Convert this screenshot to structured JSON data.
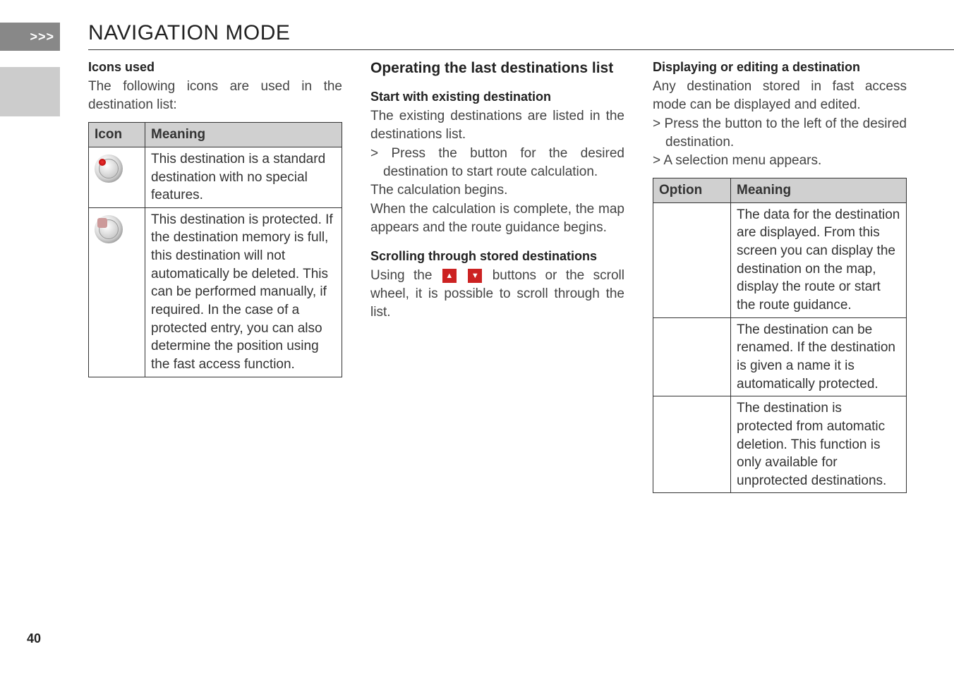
{
  "header": {
    "tab": ">>>",
    "title": "NAVIGATION MODE"
  },
  "page_number": "40",
  "col1": {
    "heading": "Icons used",
    "intro": "The following icons are used in the destination list:",
    "table": {
      "h1": "Icon",
      "h2": "Meaning",
      "r1": "This destination is a standard destination with no special features.",
      "r2": "This destination is protected. If the destination memory is full, this destination will not automatically be deleted. This can be performed manually, if required.\nIn the case of a protected entry, you can also determine the position using the fast access function."
    }
  },
  "col2": {
    "section": "Operating the last destinations list",
    "sub1": "Start with existing destination",
    "p1": "The existing destinations are listed in the destinations list.",
    "li1": "> Press the button for the desired destination to start route calculation.",
    "p2": "The calculation begins.",
    "p3": "When the calculation is complete, the map appears and the route guidance begins.",
    "sub2": "Scrolling through stored destinations",
    "p4a": "Using the ",
    "p4b": " buttons or the scroll wheel, it is possible to scroll through the list."
  },
  "col3": {
    "sub1": "Displaying or editing a destination",
    "p1": "Any destination stored in fast access mode can be displayed and edited.",
    "li1": "> Press the button to the left of the desired destination.",
    "li2": "> A selection menu appears.",
    "table": {
      "h1": "Option",
      "h2": "Meaning",
      "r1": "The data for the destination are displayed. From this screen you can display the destination on the map, display the route or start the route guidance.",
      "r2": "The destination can be renamed. If the destination is given a name it is automatically protected.",
      "r3": "The destination is protected from automatic deletion. This function is only available for unprotected destinations."
    }
  }
}
